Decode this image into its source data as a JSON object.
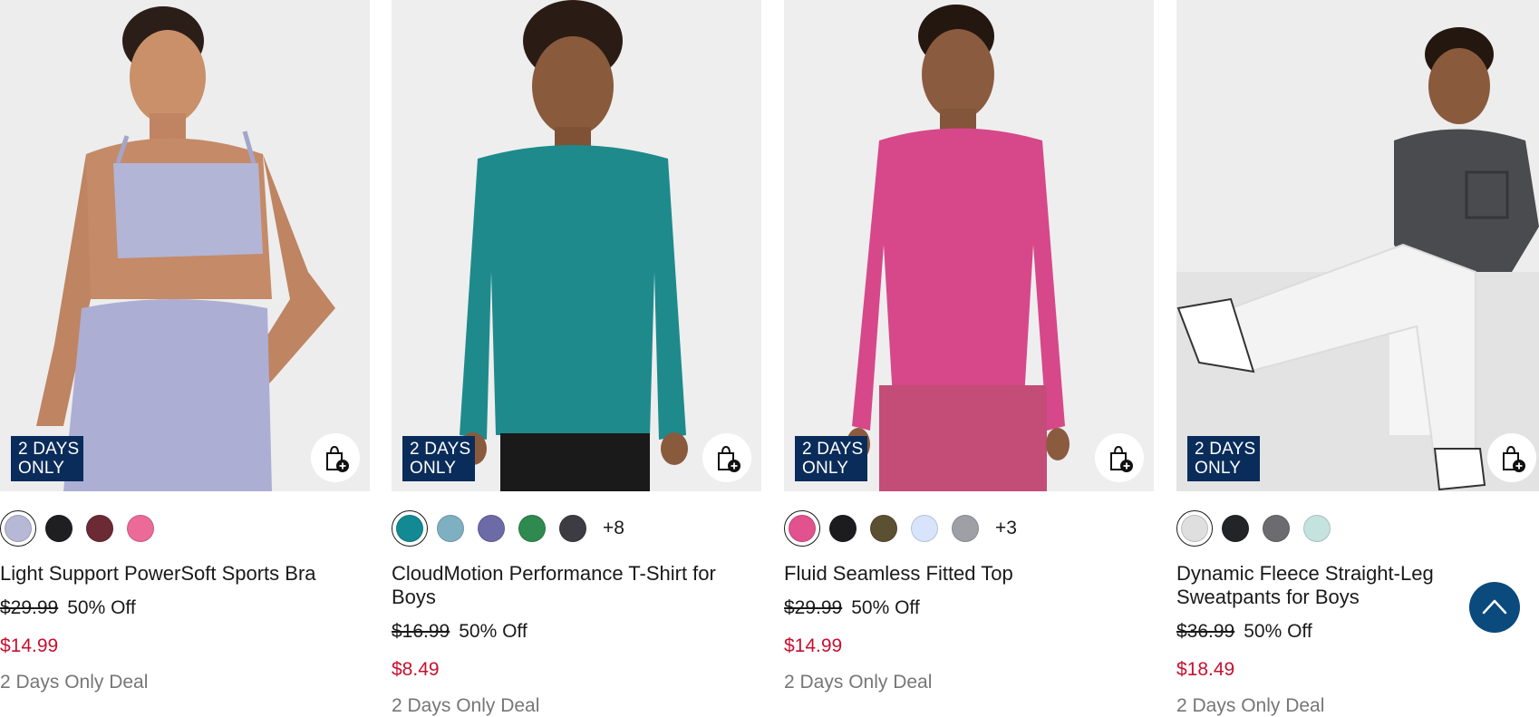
{
  "products": [
    {
      "badge_line1": "2 DAYS",
      "badge_line2": "ONLY",
      "swatches": [
        "#b6b8d6",
        "#1f1f22",
        "#6b2a34",
        "#ec6a97"
      ],
      "more_colors": "",
      "title": "Light Support PowerSoft Sports Bra",
      "original_price": "$29.99",
      "discount": "50% Off",
      "sale_price": "$14.99",
      "deal_text": "2 Days Only Deal"
    },
    {
      "badge_line1": "2 DAYS",
      "badge_line2": "ONLY",
      "swatches": [
        "#138a93",
        "#7fb0c2",
        "#6d6aa8",
        "#2e8a4e",
        "#3d3c43"
      ],
      "more_colors": "+8",
      "title": "CloudMotion Performance T-Shirt for Boys",
      "original_price": "$16.99",
      "discount": "50% Off",
      "sale_price": "$8.49",
      "deal_text": "2 Days Only Deal"
    },
    {
      "badge_line1": "2 DAYS",
      "badge_line2": "ONLY",
      "swatches": [
        "#e2528f",
        "#1c1c1f",
        "#5c5033",
        "#d8e4fb",
        "#9fa0a6"
      ],
      "more_colors": "+3",
      "title": "Fluid Seamless Fitted Top",
      "original_price": "$29.99",
      "discount": "50% Off",
      "sale_price": "$14.99",
      "deal_text": "2 Days Only Deal"
    },
    {
      "badge_line1": "2 DAYS",
      "badge_line2": "ONLY",
      "swatches": [
        "#dfdfdf",
        "#232427",
        "#6c6c70",
        "#c5e3de"
      ],
      "more_colors": "",
      "title": "Dynamic Fleece Straight-Leg Sweatpants for Boys",
      "original_price": "$36.99",
      "discount": "50% Off",
      "sale_price": "$18.49",
      "deal_text": "2 Days Only Deal"
    }
  ],
  "colors": {
    "badge_bg": "#0a2c5a",
    "sale_price": "#c8102e",
    "deal_text": "#767676",
    "back_to_top": "#0a4a7d"
  },
  "icons": {
    "add_to_bag": "bag-plus-icon",
    "back_to_top": "chevron-up-icon"
  }
}
